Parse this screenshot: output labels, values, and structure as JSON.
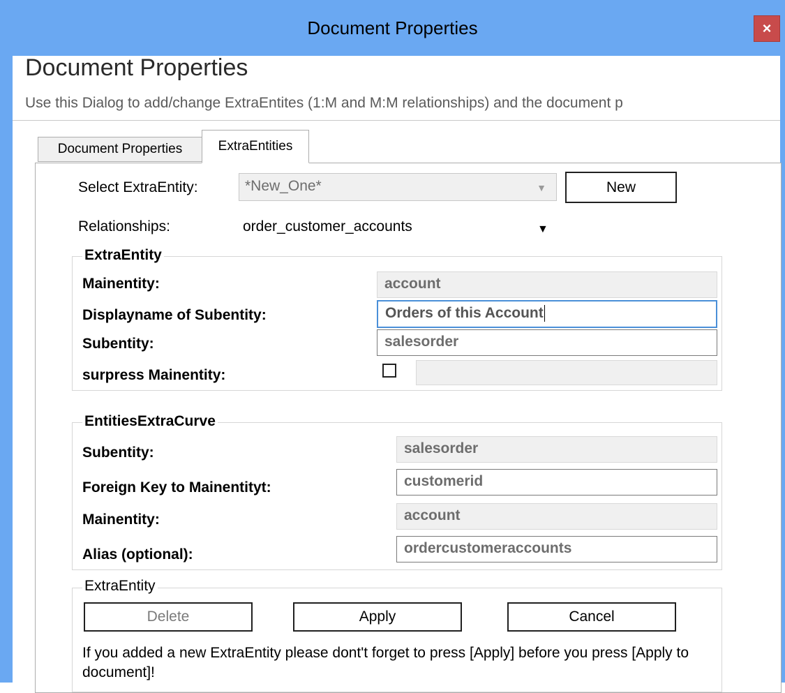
{
  "window": {
    "title": "Document Properties",
    "close_glyph": "×",
    "heading": "Document Properties",
    "subheading": "Use this Dialog to add/change ExtraEntites (1:M and M:M relationships) and the document p"
  },
  "tabs": [
    {
      "label": "Document Properties",
      "active": false
    },
    {
      "label": "ExtraEntities",
      "active": true
    }
  ],
  "select_extra_entity": {
    "label": "Select ExtraEntity:",
    "value": "*New_One*",
    "arrow": "▼",
    "new_button": "New"
  },
  "relationships": {
    "label": "Relationships:",
    "value": "order_customer_accounts",
    "arrow": "▼"
  },
  "extra_entity_group": {
    "title": "ExtraEntity",
    "mainentity_label": "Mainentity:",
    "mainentity_value": "account",
    "displayname_label": "Displayname of Subentity:",
    "displayname_value": "Orders of this Account",
    "subentity_label": "Subentity:",
    "subentity_value": "salesorder",
    "surpress_label": "surpress Mainentity:",
    "surpress_checked": false,
    "surpress_value": ""
  },
  "entities_extra_curve_group": {
    "title": "EntitiesExtraCurve",
    "subentity_label": "Subentity:",
    "subentity_value": "salesorder",
    "foreign_key_label": "Foreign Key to Mainentityt:",
    "foreign_key_value": "customerid",
    "mainentity_label": "Mainentity:",
    "mainentity_value": "account",
    "alias_label": "Alias (optional):",
    "alias_value": "ordercustomeraccounts"
  },
  "actions_group": {
    "title": "ExtraEntity",
    "delete_label": "Delete",
    "apply_label": "Apply",
    "cancel_label": "Cancel",
    "note": "If you added a new ExtraEntity please dont't forget to press [Apply] before you press [Apply to document]!"
  },
  "colors": {
    "titlebar": "#6aa8f2",
    "close_button": "#c84b4b",
    "focus_border": "#4a8fd8"
  }
}
